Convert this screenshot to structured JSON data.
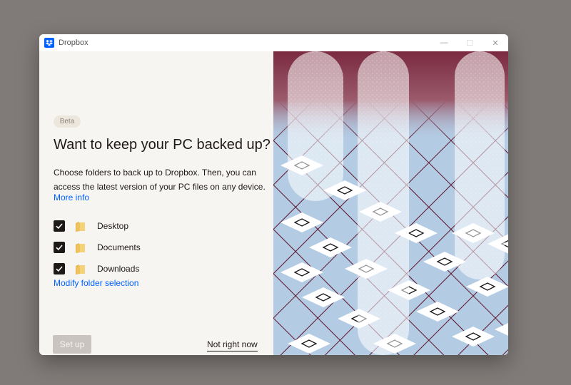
{
  "window": {
    "app_title": "Dropbox",
    "controls": {
      "minimize": "—",
      "maximize": "☐",
      "close": "✕"
    }
  },
  "content": {
    "badge": "Beta",
    "heading": "Want to keep your PC backed up?",
    "description": "Choose folders to back up to Dropbox. Then, you can access the latest version of your PC files on any device.",
    "more_info_link": "More info",
    "folders": [
      {
        "name": "Desktop",
        "checked": true
      },
      {
        "name": "Documents",
        "checked": true
      },
      {
        "name": "Downloads",
        "checked": true
      }
    ],
    "modify_link": "Modify folder selection",
    "setup_button": "Set up",
    "not_now_button": "Not right now"
  },
  "colors": {
    "desktop_bg": "#807b78",
    "panel_bg": "#f7f5f2",
    "link": "#0061fe",
    "text": "#1e1919",
    "illustration_sky": "#b3cce4",
    "illustration_lines": "#5b1128",
    "illustration_top": "#7a2a40"
  }
}
